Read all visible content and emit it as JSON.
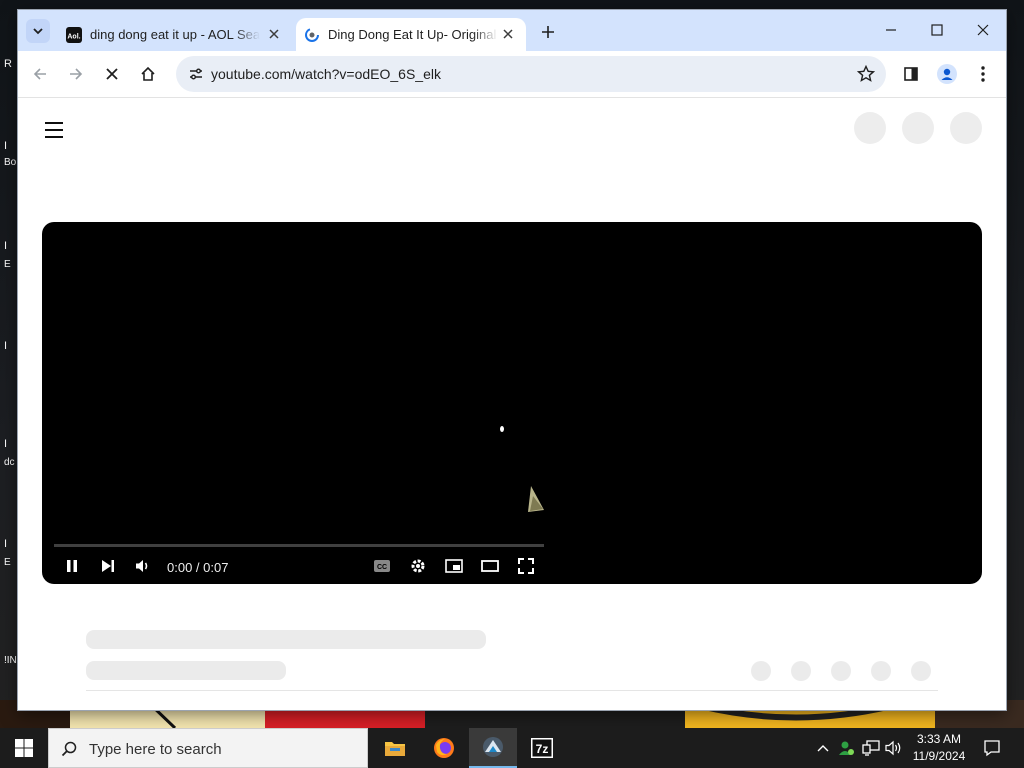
{
  "desktop": {
    "edge_letters": [
      "R",
      "I",
      "Bo",
      "I",
      "E",
      "I",
      "I",
      "dc",
      "I",
      "E",
      "!IN"
    ]
  },
  "browser": {
    "tabs": [
      {
        "title": "ding dong eat it up - AOL Search",
        "favicon": "aol-icon",
        "active": false
      },
      {
        "title": "Ding Dong Eat It Up- Original",
        "favicon": "youtube-loading-icon",
        "active": true
      }
    ],
    "url": "youtube.com/watch?v=odEO_6S_elk"
  },
  "player": {
    "time": "0:00 / 0:07",
    "progress_fraction": 0.0
  },
  "taskbar": {
    "search_placeholder": "Type here to search",
    "clock_time": "3:33 AM",
    "clock_date": "11/9/2024",
    "apps": [
      "file-explorer-icon",
      "firefox-icon",
      "app-icon",
      "7zip-icon"
    ]
  },
  "colors": {
    "tabstrip": "#d3e3fd",
    "omnibox": "#e9eef6",
    "player_bg": "#000000",
    "taskbar": "#1c1c1c"
  }
}
